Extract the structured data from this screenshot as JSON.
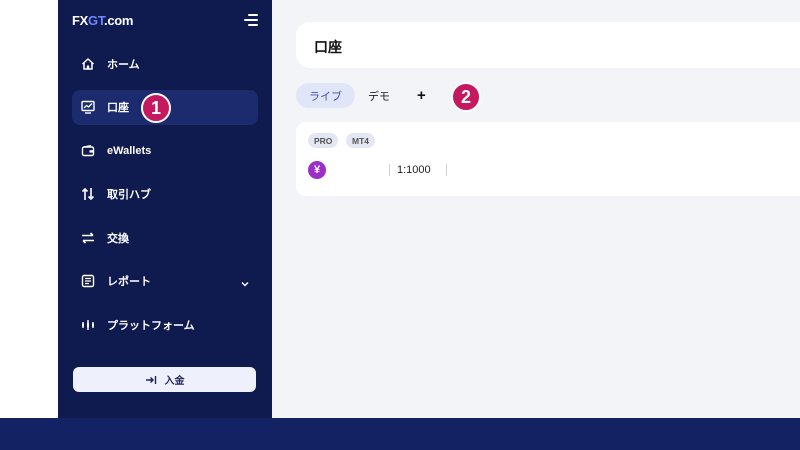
{
  "brand": {
    "logo_part1": "FX",
    "logo_part2": "GT",
    "logo_part3": ".com",
    "accent": "#6f86ff"
  },
  "sidebar": {
    "bg": "#0f1a4f",
    "items": [
      {
        "label": "ホーム",
        "icon": "home-icon"
      },
      {
        "label": "口座",
        "icon": "chart-monitor-icon",
        "active": true
      },
      {
        "label": "eWallets",
        "icon": "wallet-icon"
      },
      {
        "label": "取引ハブ",
        "icon": "arrows-updown-icon"
      },
      {
        "label": "交換",
        "icon": "exchange-icon"
      },
      {
        "label": "レポート",
        "icon": "report-icon",
        "has_chevron": true
      },
      {
        "label": "プラットフォーム",
        "icon": "platform-icon"
      }
    ],
    "deposit_label": "入金"
  },
  "markers": {
    "one": "1",
    "two": "2",
    "color": "#c4195e"
  },
  "main": {
    "title": "口座",
    "tabs": [
      {
        "label": "ライブ",
        "active": true
      },
      {
        "label": "デモ"
      }
    ],
    "add_tab": "+",
    "account": {
      "tags": [
        "PRO",
        "MT4"
      ],
      "currency_symbol": "¥",
      "leverage": "1:1000"
    }
  }
}
